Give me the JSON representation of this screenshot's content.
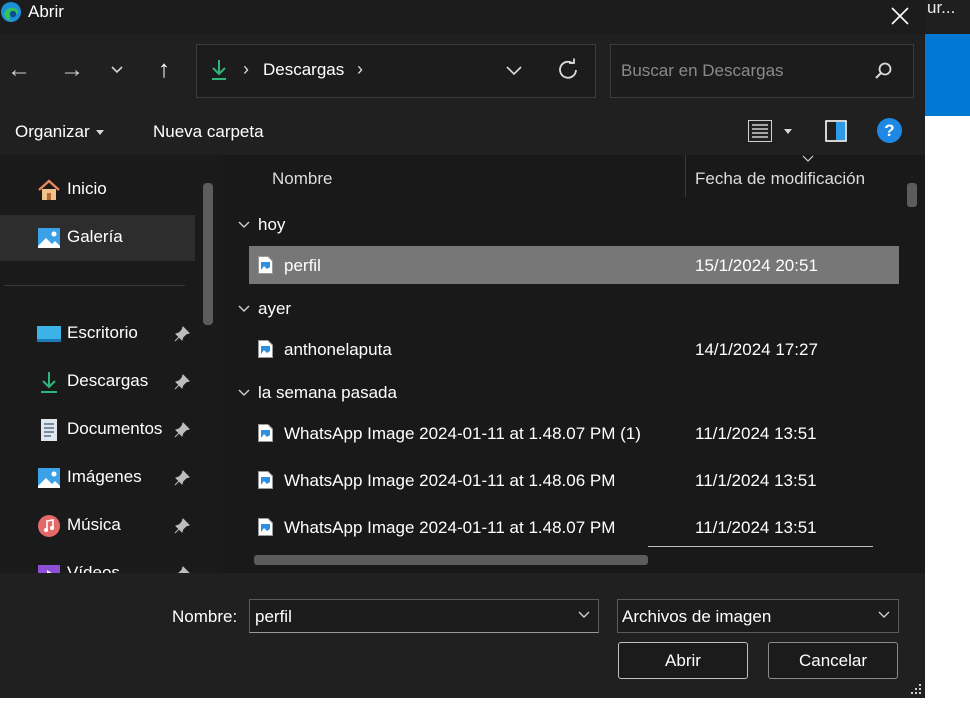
{
  "window": {
    "title": "Abrir",
    "behind_text": "ur..."
  },
  "nav": {
    "back_glyph": "←",
    "forward_glyph": "→",
    "recent_glyph": "⌄",
    "up_glyph": "↑"
  },
  "address": {
    "crumb": "Descargas",
    "sep": "›"
  },
  "search": {
    "placeholder": "Buscar en Descargas"
  },
  "toolbar": {
    "organize": "Organizar",
    "new_folder": "Nueva carpeta",
    "help": "?"
  },
  "sidebar": {
    "items": [
      {
        "label": "Inicio",
        "icon": "home-icon"
      },
      {
        "label": "Galería",
        "icon": "gallery-icon"
      },
      {
        "label": "Escritorio",
        "icon": "desktop-icon"
      },
      {
        "label": "Descargas",
        "icon": "downloads-icon"
      },
      {
        "label": "Documentos",
        "icon": "documents-icon"
      },
      {
        "label": "Imágenes",
        "icon": "pictures-icon"
      },
      {
        "label": "Música",
        "icon": "music-icon"
      },
      {
        "label": "Vídeos",
        "icon": "videos-icon"
      }
    ]
  },
  "columns": {
    "name": "Nombre",
    "date": "Fecha de modificación"
  },
  "groups": [
    {
      "label": "hoy",
      "files": [
        {
          "name": "perfil",
          "date": "15/1/2024 20:51",
          "selected": true
        }
      ]
    },
    {
      "label": "ayer",
      "files": [
        {
          "name": "anthonelaputa",
          "date": "14/1/2024 17:27"
        }
      ]
    },
    {
      "label": "la semana pasada",
      "files": [
        {
          "name": "WhatsApp Image 2024-01-11 at 1.48.07 PM (1)",
          "date": "11/1/2024 13:51"
        },
        {
          "name": "WhatsApp Image 2024-01-11 at 1.48.06 PM",
          "date": "11/1/2024 13:51"
        },
        {
          "name": "WhatsApp Image 2024-01-11 at 1.48.07 PM",
          "date": "11/1/2024 13:51"
        }
      ]
    }
  ],
  "footer": {
    "name_label": "Nombre:",
    "filename": "perfil",
    "filter": "Archivos de imagen",
    "open": "Abrir",
    "cancel": "Cancelar"
  },
  "colors": {
    "accent": "#0078d4",
    "selected_row": "#777777",
    "download_green": "#2fb67a"
  }
}
